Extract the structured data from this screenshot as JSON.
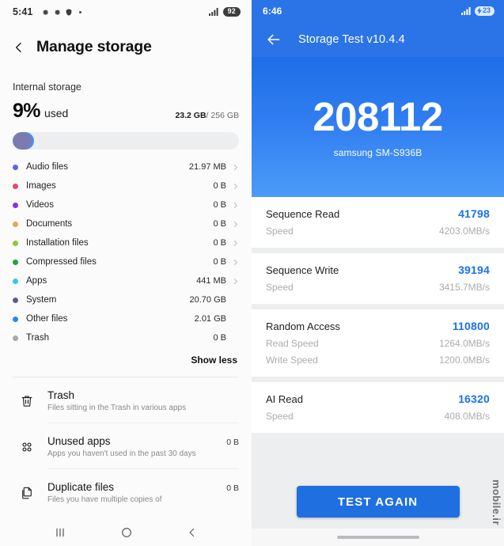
{
  "left": {
    "statusbar": {
      "time": "5:41",
      "icons": [
        "gear-icon",
        "gear-icon",
        "shield-icon",
        "dot-icon"
      ],
      "signal_icon": "signal-bars-icon",
      "battery": "92"
    },
    "appbar": {
      "back_icon": "back-chevron-icon",
      "title": "Manage storage"
    },
    "storage": {
      "section_label": "Internal storage",
      "percent": "9%",
      "used_word": "used",
      "used_amount": "23.2 GB",
      "separator": "/",
      "total_amount": "256 GB"
    },
    "categories": [
      {
        "name": "Audio files",
        "size": "21.97 MB",
        "color": "#5b63e8",
        "chevron": true
      },
      {
        "name": "Images",
        "size": "0 B",
        "color": "#f0436b",
        "chevron": true
      },
      {
        "name": "Videos",
        "size": "0 B",
        "color": "#8b2ef0",
        "chevron": true
      },
      {
        "name": "Documents",
        "size": "0 B",
        "color": "#e0a756",
        "chevron": true
      },
      {
        "name": "Installation files",
        "size": "0 B",
        "color": "#8cc930",
        "chevron": true
      },
      {
        "name": "Compressed files",
        "size": "0 B",
        "color": "#27a03c",
        "chevron": true
      },
      {
        "name": "Apps",
        "size": "441 MB",
        "color": "#31c8e8",
        "chevron": true
      },
      {
        "name": "System",
        "size": "20.70 GB",
        "color": "#5a5a96",
        "chevron": false
      },
      {
        "name": "Other files",
        "size": "2.01 GB",
        "color": "#2f86ef",
        "chevron": false
      },
      {
        "name": "Trash",
        "size": "0 B",
        "color": "#a8a8ac",
        "chevron": false
      }
    ],
    "show_less": "Show less",
    "tools": [
      {
        "icon": "trash-icon",
        "title": "Trash",
        "subtitle": "Files sitting in the Trash in various apps",
        "value": ""
      },
      {
        "icon": "apps-grid-icon",
        "title": "Unused apps",
        "subtitle": "Apps you haven't used in the past 30 days",
        "value": "0 B"
      },
      {
        "icon": "duplicate-icon",
        "title": "Duplicate files",
        "subtitle": "Files you have multiple copies of",
        "value": "0 B"
      }
    ],
    "navbar": [
      "recents-icon",
      "home-icon",
      "back-icon"
    ]
  },
  "right": {
    "statusbar": {
      "time": "6:46",
      "signal_icon": "signal-bars-icon",
      "battery": "23",
      "charging": true
    },
    "appbar": {
      "back_icon": "arrow-left-icon",
      "title": "Storage Test v10.4.4"
    },
    "hero": {
      "score": "208112",
      "model": "samsung SM-S936B"
    },
    "results": [
      {
        "name": "Sequence Read",
        "score": "41798",
        "lines": [
          {
            "label": "Speed",
            "value": "4203.0MB/s"
          }
        ]
      },
      {
        "name": "Sequence Write",
        "score": "39194",
        "lines": [
          {
            "label": "Speed",
            "value": "3415.7MB/s"
          }
        ]
      },
      {
        "name": "Random Access",
        "score": "110800",
        "lines": [
          {
            "label": "Read Speed",
            "value": "1264.0MB/s"
          },
          {
            "label": "Write Speed",
            "value": "1200.0MB/s"
          }
        ]
      },
      {
        "name": "AI Read",
        "score": "16320",
        "lines": [
          {
            "label": "Speed",
            "value": "408.0MB/s"
          }
        ]
      }
    ],
    "test_again": "TEST AGAIN",
    "watermark": "mobile.ir"
  }
}
